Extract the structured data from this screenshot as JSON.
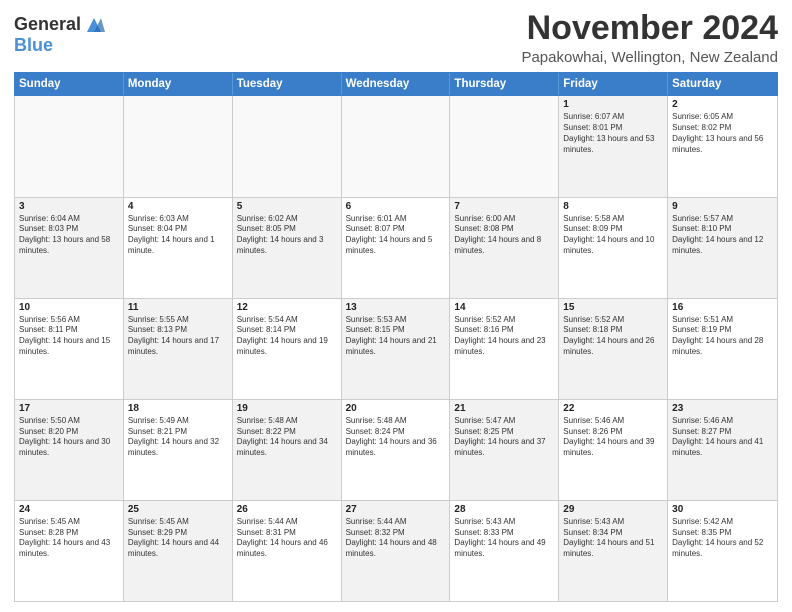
{
  "logo": {
    "line1": "General",
    "line2": "Blue"
  },
  "title": "November 2024",
  "subtitle": "Papakowhai, Wellington, New Zealand",
  "days": [
    "Sunday",
    "Monday",
    "Tuesday",
    "Wednesday",
    "Thursday",
    "Friday",
    "Saturday"
  ],
  "rows": [
    [
      {
        "day": "",
        "content": "",
        "empty": true
      },
      {
        "day": "",
        "content": "",
        "empty": true
      },
      {
        "day": "",
        "content": "",
        "empty": true
      },
      {
        "day": "",
        "content": "",
        "empty": true
      },
      {
        "day": "",
        "content": "",
        "empty": true
      },
      {
        "day": "1",
        "content": "Sunrise: 6:07 AM\nSunset: 8:01 PM\nDaylight: 13 hours and 53 minutes.",
        "shaded": true
      },
      {
        "day": "2",
        "content": "Sunrise: 6:05 AM\nSunset: 8:02 PM\nDaylight: 13 hours and 56 minutes.",
        "shaded": false
      }
    ],
    [
      {
        "day": "3",
        "content": "Sunrise: 6:04 AM\nSunset: 8:03 PM\nDaylight: 13 hours and 58 minutes.",
        "shaded": true
      },
      {
        "day": "4",
        "content": "Sunrise: 6:03 AM\nSunset: 8:04 PM\nDaylight: 14 hours and 1 minute.",
        "shaded": false
      },
      {
        "day": "5",
        "content": "Sunrise: 6:02 AM\nSunset: 8:05 PM\nDaylight: 14 hours and 3 minutes.",
        "shaded": true
      },
      {
        "day": "6",
        "content": "Sunrise: 6:01 AM\nSunset: 8:07 PM\nDaylight: 14 hours and 5 minutes.",
        "shaded": false
      },
      {
        "day": "7",
        "content": "Sunrise: 6:00 AM\nSunset: 8:08 PM\nDaylight: 14 hours and 8 minutes.",
        "shaded": true
      },
      {
        "day": "8",
        "content": "Sunrise: 5:58 AM\nSunset: 8:09 PM\nDaylight: 14 hours and 10 minutes.",
        "shaded": false
      },
      {
        "day": "9",
        "content": "Sunrise: 5:57 AM\nSunset: 8:10 PM\nDaylight: 14 hours and 12 minutes.",
        "shaded": true
      }
    ],
    [
      {
        "day": "10",
        "content": "Sunrise: 5:56 AM\nSunset: 8:11 PM\nDaylight: 14 hours and 15 minutes.",
        "shaded": false
      },
      {
        "day": "11",
        "content": "Sunrise: 5:55 AM\nSunset: 8:13 PM\nDaylight: 14 hours and 17 minutes.",
        "shaded": true
      },
      {
        "day": "12",
        "content": "Sunrise: 5:54 AM\nSunset: 8:14 PM\nDaylight: 14 hours and 19 minutes.",
        "shaded": false
      },
      {
        "day": "13",
        "content": "Sunrise: 5:53 AM\nSunset: 8:15 PM\nDaylight: 14 hours and 21 minutes.",
        "shaded": true
      },
      {
        "day": "14",
        "content": "Sunrise: 5:52 AM\nSunset: 8:16 PM\nDaylight: 14 hours and 23 minutes.",
        "shaded": false
      },
      {
        "day": "15",
        "content": "Sunrise: 5:52 AM\nSunset: 8:18 PM\nDaylight: 14 hours and 26 minutes.",
        "shaded": true
      },
      {
        "day": "16",
        "content": "Sunrise: 5:51 AM\nSunset: 8:19 PM\nDaylight: 14 hours and 28 minutes.",
        "shaded": false
      }
    ],
    [
      {
        "day": "17",
        "content": "Sunrise: 5:50 AM\nSunset: 8:20 PM\nDaylight: 14 hours and 30 minutes.",
        "shaded": true
      },
      {
        "day": "18",
        "content": "Sunrise: 5:49 AM\nSunset: 8:21 PM\nDaylight: 14 hours and 32 minutes.",
        "shaded": false
      },
      {
        "day": "19",
        "content": "Sunrise: 5:48 AM\nSunset: 8:22 PM\nDaylight: 14 hours and 34 minutes.",
        "shaded": true
      },
      {
        "day": "20",
        "content": "Sunrise: 5:48 AM\nSunset: 8:24 PM\nDaylight: 14 hours and 36 minutes.",
        "shaded": false
      },
      {
        "day": "21",
        "content": "Sunrise: 5:47 AM\nSunset: 8:25 PM\nDaylight: 14 hours and 37 minutes.",
        "shaded": true
      },
      {
        "day": "22",
        "content": "Sunrise: 5:46 AM\nSunset: 8:26 PM\nDaylight: 14 hours and 39 minutes.",
        "shaded": false
      },
      {
        "day": "23",
        "content": "Sunrise: 5:46 AM\nSunset: 8:27 PM\nDaylight: 14 hours and 41 minutes.",
        "shaded": true
      }
    ],
    [
      {
        "day": "24",
        "content": "Sunrise: 5:45 AM\nSunset: 8:28 PM\nDaylight: 14 hours and 43 minutes.",
        "shaded": false
      },
      {
        "day": "25",
        "content": "Sunrise: 5:45 AM\nSunset: 8:29 PM\nDaylight: 14 hours and 44 minutes.",
        "shaded": true
      },
      {
        "day": "26",
        "content": "Sunrise: 5:44 AM\nSunset: 8:31 PM\nDaylight: 14 hours and 46 minutes.",
        "shaded": false
      },
      {
        "day": "27",
        "content": "Sunrise: 5:44 AM\nSunset: 8:32 PM\nDaylight: 14 hours and 48 minutes.",
        "shaded": true
      },
      {
        "day": "28",
        "content": "Sunrise: 5:43 AM\nSunset: 8:33 PM\nDaylight: 14 hours and 49 minutes.",
        "shaded": false
      },
      {
        "day": "29",
        "content": "Sunrise: 5:43 AM\nSunset: 8:34 PM\nDaylight: 14 hours and 51 minutes.",
        "shaded": true
      },
      {
        "day": "30",
        "content": "Sunrise: 5:42 AM\nSunset: 8:35 PM\nDaylight: 14 hours and 52 minutes.",
        "shaded": false
      }
    ]
  ]
}
